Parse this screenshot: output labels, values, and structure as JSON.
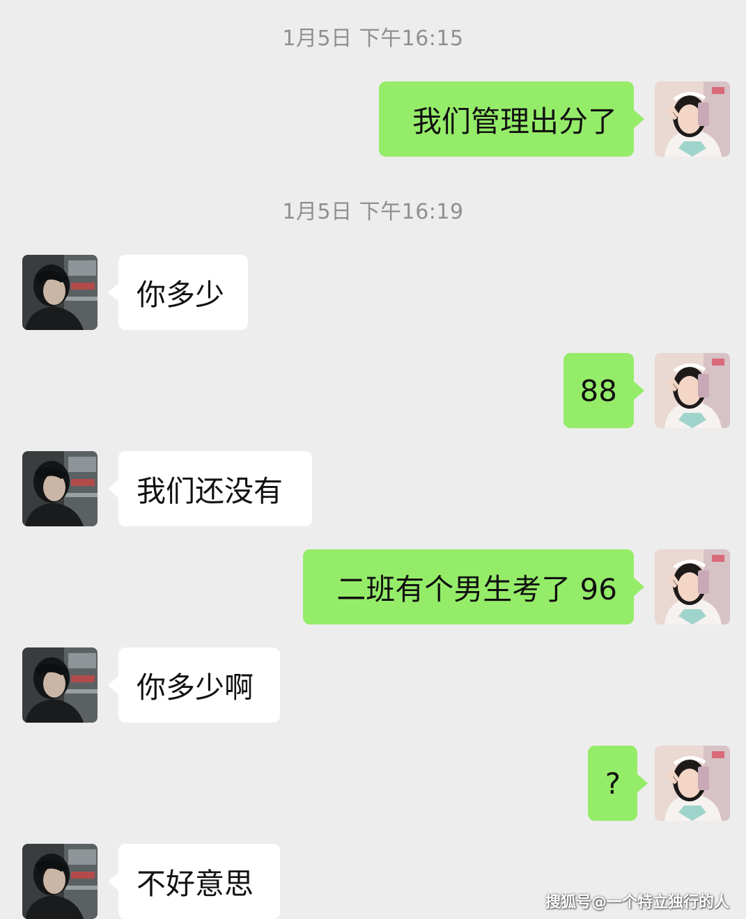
{
  "timestamps": [
    "1月5日 下午16:15",
    "1月5日 下午16:19"
  ],
  "messages": [
    {
      "from": "me",
      "text": "我们管理出分了"
    },
    {
      "from": "other",
      "text": "你多少"
    },
    {
      "from": "me",
      "text": "88"
    },
    {
      "from": "other",
      "text": "我们还没有"
    },
    {
      "from": "me",
      "text": "二班有个男生考了 96"
    },
    {
      "from": "other",
      "text": "你多少啊"
    },
    {
      "from": "me",
      "text": "?"
    },
    {
      "from": "other",
      "text": "不好意思"
    }
  ],
  "watermark": "搜狐号@一个特立独行的人",
  "colors": {
    "background": "#ededed",
    "sent_bubble": "#95ec69",
    "received_bubble": "#ffffff",
    "timestamp": "#8f8f8f"
  },
  "icons": {
    "me_avatar": "girl-photo-avatar",
    "other_avatar": "boy-photo-avatar"
  }
}
